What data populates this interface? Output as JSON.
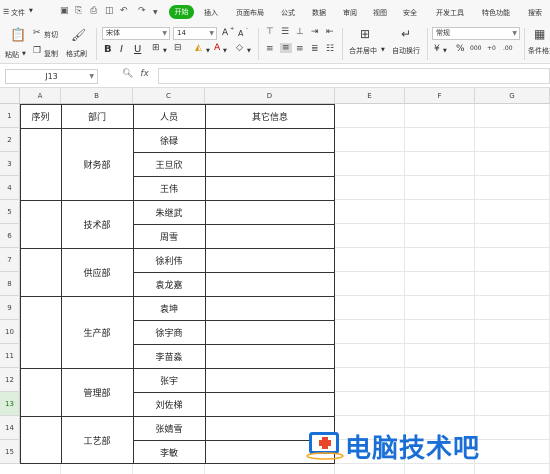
{
  "menubar": {
    "file_menu": "文件",
    "start_tab": "开始",
    "tabs": [
      "插入",
      "页面布局",
      "公式",
      "数据",
      "审阅",
      "视图",
      "安全",
      "开发工具",
      "特色功能",
      "搜索"
    ]
  },
  "toolbar": {
    "paste": "粘贴",
    "cut": "剪切",
    "copy": "复制",
    "format_painter": "格式刷",
    "font_name": "宋体",
    "font_size": "14",
    "bold": "B",
    "italic": "I",
    "underline": "U",
    "grow_font": "A",
    "shrink_font": "A",
    "merge_center": "合并居中",
    "wrap_text": "自动换行",
    "number_format": "常规",
    "currency": "¥",
    "percent": "%",
    "thousands": "000",
    "inc_decimal": "+0",
    "dec_decimal": ".00",
    "conditional_format": "条件格式"
  },
  "formula_bar": {
    "cell_ref": "J13",
    "fx": "fx",
    "value": ""
  },
  "columns": [
    "A",
    "B",
    "C",
    "D",
    "E",
    "F",
    "G"
  ],
  "rows": [
    "1",
    "2",
    "3",
    "4",
    "5",
    "6",
    "7",
    "8",
    "9",
    "10",
    "11",
    "12",
    "13",
    "14",
    "15"
  ],
  "selected_row": "13",
  "table": {
    "headers": [
      "序列",
      "部门",
      "人员",
      "其它信息"
    ],
    "departments": [
      "财务部",
      "技术部",
      "供应部",
      "生产部",
      "管理部",
      "工艺部"
    ],
    "staff": [
      "徐碌",
      "王旦欣",
      "王伟",
      "朱继武",
      "周雪",
      "徐利伟",
      "袁龙嘉",
      "袁坤",
      "徐宇商",
      "李苗淼",
      "张宇",
      "刘佐梯",
      "张婧雪",
      "李敏"
    ]
  },
  "watermark": {
    "text": "电脑技术吧"
  },
  "colors": {
    "accent_green": "#1aad19",
    "watermark_blue": "#1a6fd6"
  }
}
